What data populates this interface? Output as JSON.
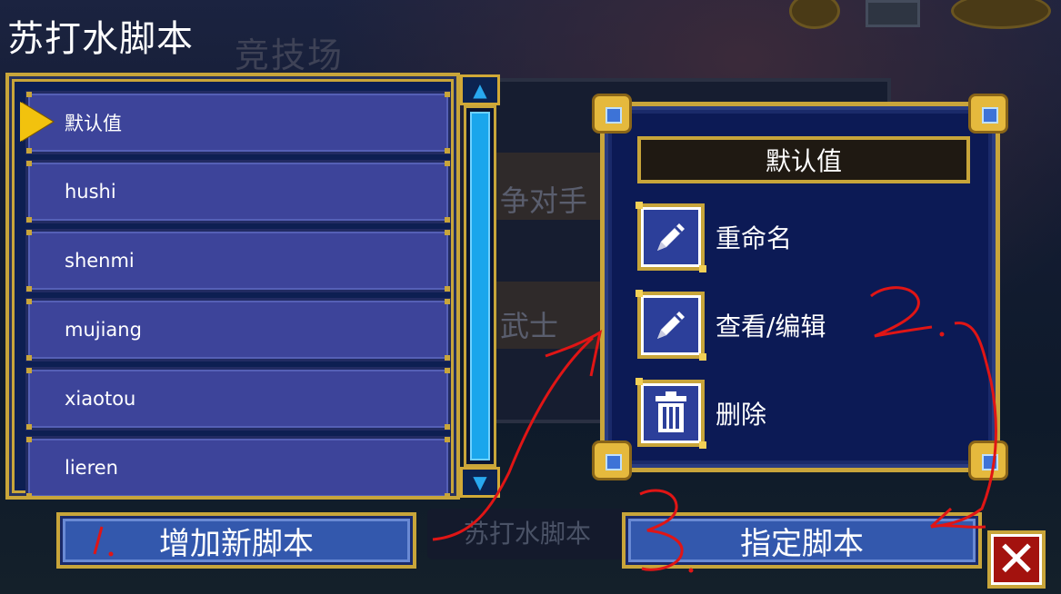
{
  "app": {
    "title": "苏打水脚本"
  },
  "background": {
    "tab_label": "竞技场",
    "rival_text": "争对手",
    "class_text": "武士",
    "footer_label": "苏打水脚本"
  },
  "script_list": {
    "selected_index": 0,
    "items": [
      {
        "label": "默认值"
      },
      {
        "label": "hushi"
      },
      {
        "label": "shenmi"
      },
      {
        "label": "mujiang"
      },
      {
        "label": "xiaotou"
      },
      {
        "label": "lieren"
      }
    ],
    "scroll": {
      "up_icon": "arrow-up-icon",
      "down_icon": "arrow-down-icon",
      "thumb_position": 0,
      "thumb_size": 1
    }
  },
  "popup": {
    "title": "默认值",
    "actions": [
      {
        "label": "重命名",
        "icon": "pencil-icon"
      },
      {
        "label": "查看/编辑",
        "icon": "pencil-icon"
      },
      {
        "label": "删除",
        "icon": "trash-icon"
      }
    ]
  },
  "buttons": {
    "add_new_script": "增加新脚本",
    "assign_script": "指定脚本",
    "close_icon": "close-icon"
  },
  "annotations": {
    "color": "#e01515",
    "marks": [
      "1.",
      "2.",
      "3."
    ]
  }
}
